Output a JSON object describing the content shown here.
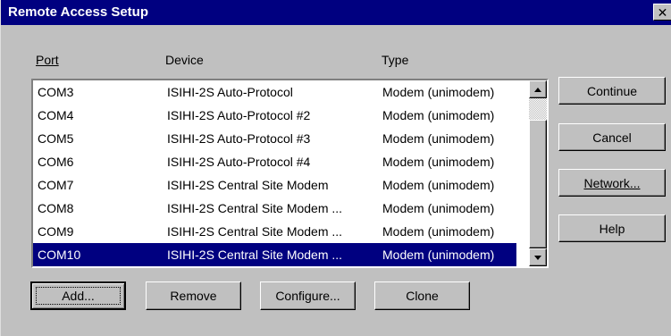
{
  "window": {
    "title": "Remote Access Setup",
    "close_glyph": "✕"
  },
  "columns": {
    "port_label": "Port",
    "device_label": "Device",
    "type_label": "Type"
  },
  "rows": [
    {
      "port": "COM3",
      "device": "ISIHI-2S Auto-Protocol",
      "type": "Modem (unimodem)",
      "selected": false
    },
    {
      "port": "COM4",
      "device": "ISIHI-2S Auto-Protocol #2",
      "type": "Modem (unimodem)",
      "selected": false
    },
    {
      "port": "COM5",
      "device": "ISIHI-2S Auto-Protocol #3",
      "type": "Modem (unimodem)",
      "selected": false
    },
    {
      "port": "COM6",
      "device": "ISIHI-2S Auto-Protocol #4",
      "type": "Modem (unimodem)",
      "selected": false
    },
    {
      "port": "COM7",
      "device": "ISIHI-2S Central Site Modem",
      "type": "Modem (unimodem)",
      "selected": false
    },
    {
      "port": "COM8",
      "device": "ISIHI-2S Central Site Modem ...",
      "type": "Modem (unimodem)",
      "selected": false
    },
    {
      "port": "COM9",
      "device": "ISIHI-2S Central Site Modem ...",
      "type": "Modem (unimodem)",
      "selected": false
    },
    {
      "port": "COM10",
      "device": "ISIHI-2S Central Site Modem ...",
      "type": "Modem (unimodem)",
      "selected": true
    }
  ],
  "side_buttons": {
    "continue": "Continue",
    "cancel": "Cancel",
    "network": "Network...",
    "help": "Help"
  },
  "bottom_buttons": {
    "add": "Add...",
    "remove": "Remove",
    "configure": "Configure...",
    "clone": "Clone"
  },
  "colors": {
    "titlebar": "#000080",
    "face": "#c0c0c0",
    "selection": "#000080"
  }
}
